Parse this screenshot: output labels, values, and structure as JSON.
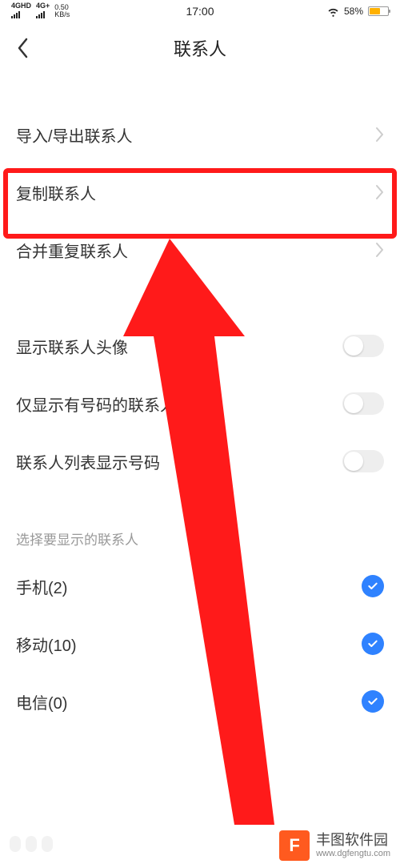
{
  "status": {
    "sim1": "4GHD",
    "sim2": "4G+",
    "speed_value": "0.50",
    "speed_unit": "KB/s",
    "time": "17:00",
    "battery_pct": "58%"
  },
  "nav": {
    "title": "联系人"
  },
  "section1": {
    "items": [
      {
        "label": "导入/导出联系人"
      },
      {
        "label": "复制联系人"
      },
      {
        "label": "合并重复联系人"
      }
    ]
  },
  "section2": {
    "items": [
      {
        "label": "显示联系人头像",
        "on": false
      },
      {
        "label": "仅显示有号码的联系人",
        "on": false
      },
      {
        "label": "联系人列表显示号码",
        "on": false
      }
    ]
  },
  "section3": {
    "header": "选择要显示的联系人",
    "items": [
      {
        "label": "手机(2)",
        "checked": true
      },
      {
        "label": "移动(10)",
        "checked": true
      },
      {
        "label": "电信(0)",
        "checked": true
      }
    ]
  },
  "watermark": {
    "logo_letter": "F",
    "name": "丰图软件园",
    "url": "www.dgfengtu.com"
  }
}
